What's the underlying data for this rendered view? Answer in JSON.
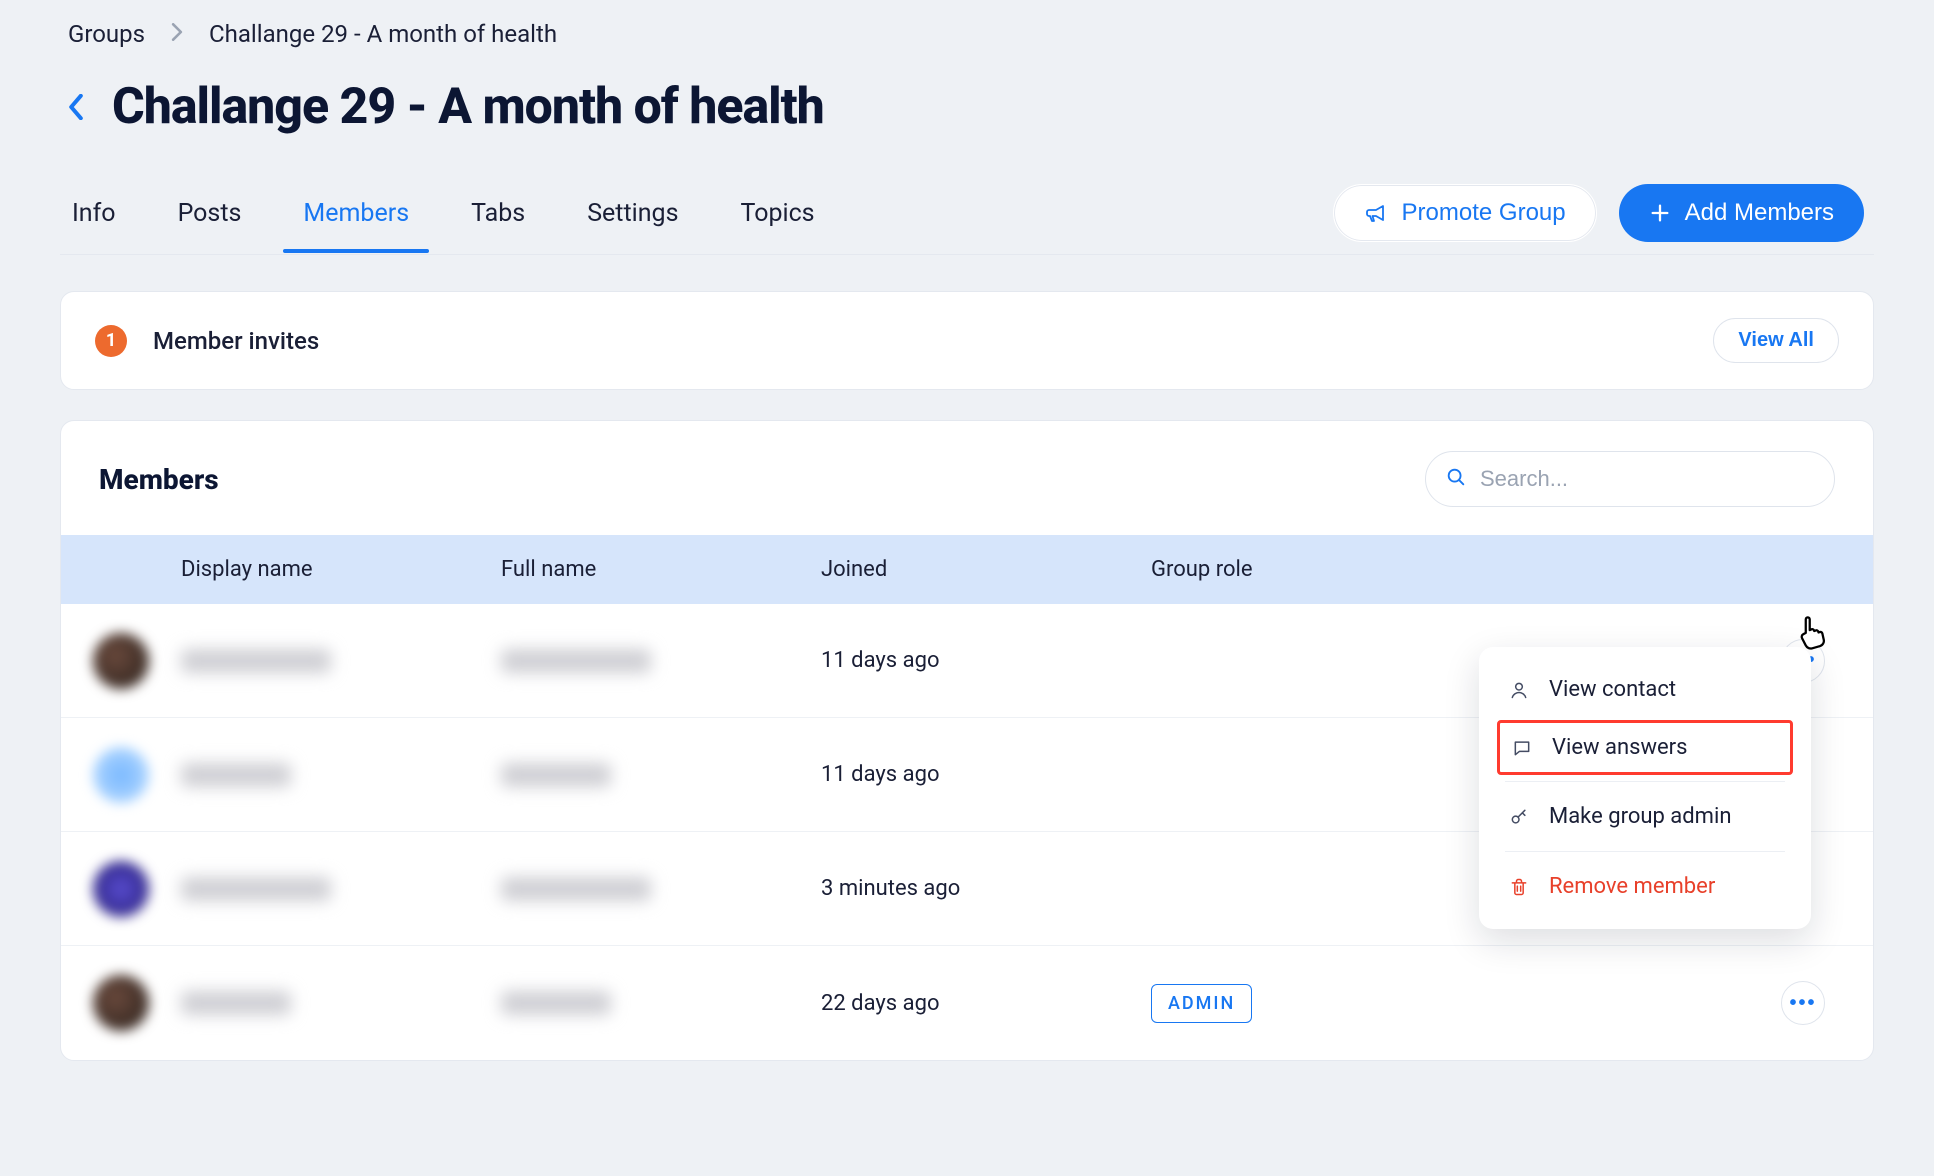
{
  "breadcrumb": {
    "root": "Groups",
    "current": "Challange 29 - A month of health"
  },
  "page": {
    "title": "Challange 29 - A month of health"
  },
  "tabs": {
    "info": "Info",
    "posts": "Posts",
    "members": "Members",
    "tabs_": "Tabs",
    "settings": "Settings",
    "topics": "Topics",
    "active": "members"
  },
  "actions": {
    "promote": "Promote Group",
    "add_members": "Add Members"
  },
  "invites": {
    "count": "1",
    "label": "Member invites",
    "view_all": "View All"
  },
  "members": {
    "title": "Members",
    "search_placeholder": "Search...",
    "columns": {
      "display_name": "Display name",
      "full_name": "Full name",
      "joined": "Joined",
      "group_role": "Group role"
    },
    "rows": [
      {
        "joined": "11 days ago",
        "role": ""
      },
      {
        "joined": "11 days ago",
        "role": ""
      },
      {
        "joined": "3 minutes ago",
        "role": ""
      },
      {
        "joined": "22 days ago",
        "role": "ADMIN"
      }
    ]
  },
  "dropdown": {
    "view_contact": "View contact",
    "view_answers": "View answers",
    "make_admin": "Make group admin",
    "remove": "Remove member"
  }
}
